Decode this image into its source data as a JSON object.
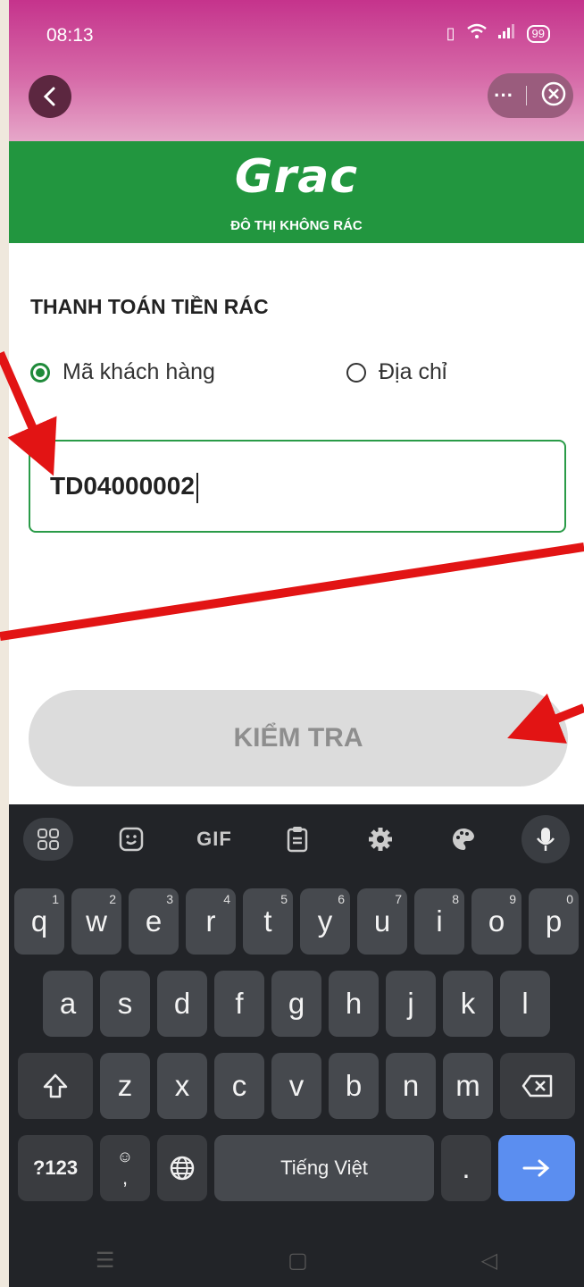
{
  "status": {
    "time": "08:13",
    "battery": "99"
  },
  "header": {
    "brand": "Grac",
    "tagline": "ĐÔ THỊ KHÔNG RÁC"
  },
  "form": {
    "title": "THANH TOÁN TIỀN RÁC",
    "option_customer": "Mã khách hàng",
    "option_address": "Địa chỉ",
    "selected": "Mã khách hàng",
    "input_value": "TD04000002",
    "check_button": "KIỂM TRA"
  },
  "keyboard": {
    "row1": [
      "q",
      "w",
      "e",
      "r",
      "t",
      "y",
      "u",
      "i",
      "o",
      "p"
    ],
    "row1_digits": [
      "1",
      "2",
      "3",
      "4",
      "5",
      "6",
      "7",
      "8",
      "9",
      "0"
    ],
    "row2": [
      "a",
      "s",
      "d",
      "f",
      "g",
      "h",
      "j",
      "k",
      "l"
    ],
    "row3": [
      "z",
      "x",
      "c",
      "v",
      "b",
      "n",
      "m"
    ],
    "symbols_key": "?123",
    "comma_key": ",",
    "space_label": "Tiếng Việt",
    "period_key": ".",
    "gif_label": "GIF"
  },
  "colors": {
    "brand_green": "#22963f",
    "header_pink": "#c5338c",
    "annotation_red": "#e21414",
    "go_blue": "#5b8ef0"
  }
}
